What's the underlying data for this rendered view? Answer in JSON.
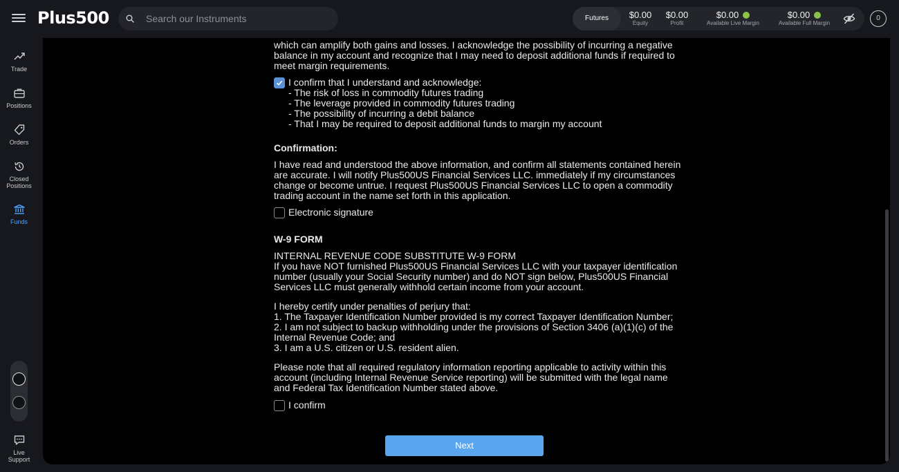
{
  "header": {
    "logo_text": "Plus500",
    "search_placeholder": "Search our Instruments",
    "futures_label": "Futures",
    "stats": [
      {
        "value": "$0.00",
        "label": "Equity"
      },
      {
        "value": "$0.00",
        "label": "Profit"
      },
      {
        "value": "$0.00",
        "label": "Available Live Margin"
      },
      {
        "value": "$0.00",
        "label": "Available Full Margin"
      }
    ],
    "avatar_text": "0"
  },
  "nav": {
    "items": [
      {
        "label": "Trade"
      },
      {
        "label": "Positions"
      },
      {
        "label": "Orders"
      },
      {
        "label_line1": "Closed",
        "label_line2": "Positions"
      },
      {
        "label": "Funds"
      },
      {
        "label_line1": "Live",
        "label_line2": "Support"
      }
    ]
  },
  "content": {
    "intro_lines": [
      "which can amplify both gains and losses. I acknowledge the possibility of incurring a negative",
      "balance in my account and recognize that I may need to deposit additional funds if required to",
      "meet margin requirements."
    ],
    "ack_checkbox_lines": [
      "I confirm that I understand and acknowledge:",
      "- The risk of loss in commodity futures trading",
      "- The leverage provided in commodity futures trading",
      "- The possibility of incurring a debit balance",
      "- That I may be required to deposit additional funds to margin my account"
    ],
    "confirmation_heading": "Confirmation:",
    "confirmation_lines": [
      "I have read and understood the above information, and confirm all statements contained herein",
      "are accurate. I will notify Plus500US Financial Services LLC. immediately if my circumstances",
      "change or become untrue. I request Plus500US Financial Services LLC to open a commodity",
      "trading account in the name set forth in this application."
    ],
    "signature_label": "Electronic signature",
    "w9_heading": "W-9 FORM",
    "w9_lines": [
      "INTERNAL REVENUE CODE SUBSTITUTE W-9 FORM",
      "If you have NOT furnished Plus500US Financial Services LLC with your taxpayer identification",
      "number (usually your Social Security number) and do NOT sign below, Plus500US Financial",
      "Services LLC must generally withhold certain income from your account."
    ],
    "certify_lines": [
      "I hereby certify under penalties of perjury that:",
      "1. The Taxpayer Identification Number provided is my correct Taxpayer Identification Number;",
      "2. I am not subject to backup withholding under the provisions of Section 3406 (a)(1)(c) of the",
      "Internal Revenue Code; and",
      "3. I am a U.S. citizen or U.S. resident alien."
    ],
    "note_lines": [
      "Please note that all required regulatory information reporting applicable to activity within this",
      "account (including Internal Revenue Service reporting) will be submitted with the legal name",
      "and Federal Tax Identification Number stated above."
    ],
    "confirm_label": "I confirm",
    "next_label": "Next"
  },
  "colors": {
    "accent": "#5aa6ee",
    "checkbox_checked": "#5b8fd6",
    "status_green": "#8bc34a",
    "active_nav": "#4da3ff"
  }
}
